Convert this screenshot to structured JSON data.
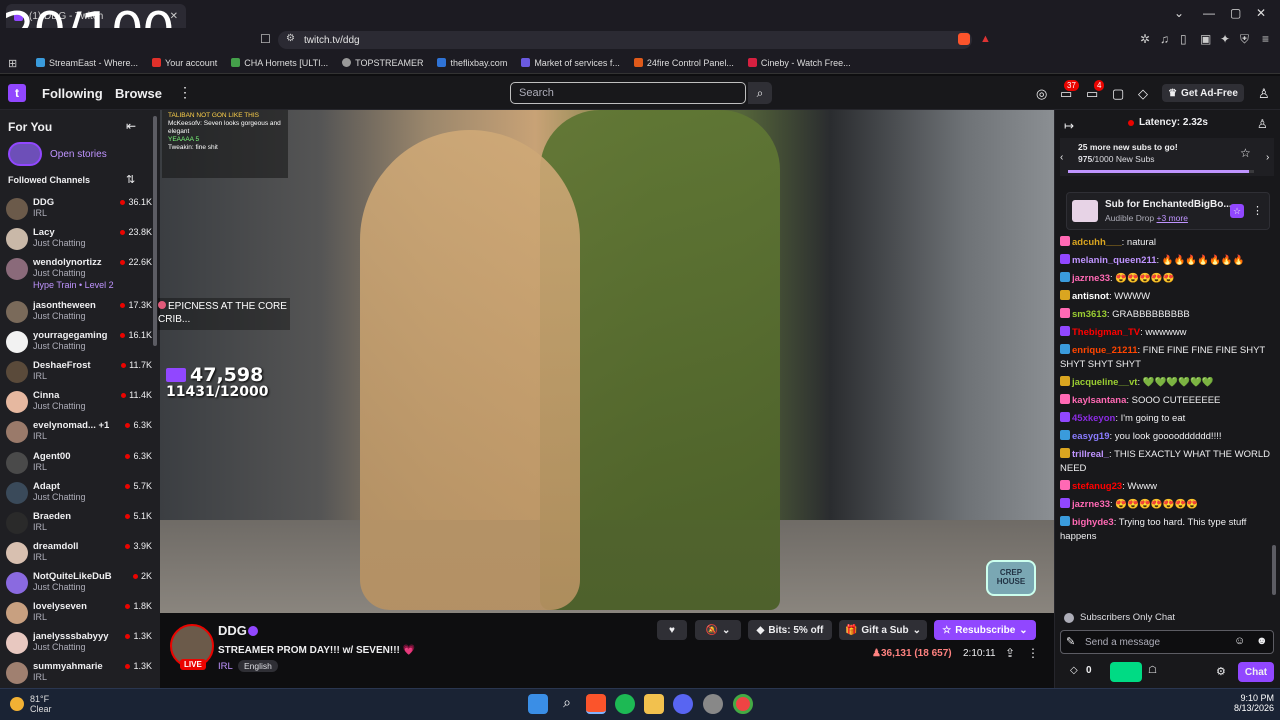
{
  "browser": {
    "tab_title": "(1) DDG - Twitch",
    "url": "twitch.tv/ddg",
    "overlay_counter": "20/100",
    "bookmarks": [
      {
        "label": "StreamEast - Where...",
        "color": "#3a9bdc"
      },
      {
        "label": "Your account",
        "color": "#e0302a"
      },
      {
        "label": "CHA Hornets [ULTI...",
        "color": "#44a04a"
      },
      {
        "label": "TOPSTREAMER",
        "color": "#999999"
      },
      {
        "label": "theflixbay.com",
        "color": "#2f73d6"
      },
      {
        "label": "Market of services f...",
        "color": "#6a5ae0"
      },
      {
        "label": "24fire Control Panel...",
        "color": "#e05a1a"
      },
      {
        "label": "Cineby - Watch Free...",
        "color": "#d62040"
      }
    ]
  },
  "header": {
    "following": "Following",
    "browse": "Browse",
    "search_placeholder": "Search",
    "notif_count": "37",
    "inbox_count": "4",
    "ad_free": "Get Ad-Free"
  },
  "sidebar": {
    "for_you": "For You",
    "open_stories": "Open stories",
    "followed_channels": "Followed Channels",
    "channels": [
      {
        "name": "DDG",
        "category": "IRL",
        "viewers": "36.1K",
        "color": "#6b5a4a"
      },
      {
        "name": "Lacy",
        "category": "Just Chatting",
        "viewers": "23.8K",
        "color": "#c9b8a8"
      },
      {
        "name": "wendolynortizz",
        "category": "Just Chatting",
        "viewers": "22.6K",
        "hype": "Hype Train • Level 2",
        "color": "#8a6a7a"
      },
      {
        "name": "jasontheween",
        "category": "Just Chatting",
        "viewers": "17.3K",
        "color": "#7a6a5a"
      },
      {
        "name": "yourragegaming",
        "category": "Just Chatting",
        "viewers": "16.1K",
        "color": "#f2f2f2"
      },
      {
        "name": "DeshaeFrost",
        "category": "IRL",
        "viewers": "11.7K",
        "color": "#5a4a3a"
      },
      {
        "name": "Cinna",
        "category": "Just Chatting",
        "viewers": "11.4K",
        "color": "#e6b8a0"
      },
      {
        "name": "evelynomad... +1",
        "category": "IRL",
        "viewers": "6.3K",
        "color": "#9a7a6a"
      },
      {
        "name": "Agent00",
        "category": "IRL",
        "viewers": "6.3K",
        "color": "#4a4a4a"
      },
      {
        "name": "Adapt",
        "category": "Just Chatting",
        "viewers": "5.7K",
        "color": "#3a4a5a"
      },
      {
        "name": "Braeden",
        "category": "IRL",
        "viewers": "5.1K",
        "color": "#2a2a2a"
      },
      {
        "name": "dreamdoll",
        "category": "IRL",
        "viewers": "3.9K",
        "color": "#d8c0b0"
      },
      {
        "name": "NotQuiteLikeDuB",
        "category": "Just Chatting",
        "viewers": "2K",
        "color": "#8a6ae0"
      },
      {
        "name": "lovelyseven",
        "category": "IRL",
        "viewers": "1.8K",
        "color": "#c8a080"
      },
      {
        "name": "janelysssbabyyy",
        "category": "Just Chatting",
        "viewers": "1.3K",
        "color": "#e8c8c0"
      },
      {
        "name": "summyahmarie",
        "category": "IRL",
        "viewers": "1.3K",
        "color": "#a08070"
      }
    ]
  },
  "video_overlay": {
    "chat_lines": [
      {
        "text": "TALIBAN NOT GON LIKE THIS",
        "color": "#ffffff"
      },
      {
        "text": "McKeesofv: Seven looks gorgeous and elegant",
        "color": "#ffffff"
      },
      {
        "text": "YEAAAA 5",
        "color": "#7cff7c"
      },
      {
        "text": "Tweakin: fine shit",
        "color": "#ffffff"
      }
    ],
    "caption": "EPICNESS AT THE CORE CRIB...",
    "sub_count": "47,598",
    "sub_goal": "11431/12000",
    "logo_text": "CREP HOUSE"
  },
  "stream_info": {
    "channel": "DDG",
    "live": "LIVE",
    "title": "STREAMER PROM DAY!!! w/ SEVEN!!! 💗",
    "category": "IRL",
    "language": "English",
    "bits": "Bits: 5% off",
    "gift": "Gift a Sub",
    "resub": "Resubscribe",
    "viewers": "36,131 (18 657)",
    "uptime": "2:10:11"
  },
  "chat": {
    "latency": "Latency: 2.32s",
    "goal_line1": "25 more new subs to go!",
    "goal_count": "975",
    "goal_line2": "/1000 New Subs",
    "goal_fraction": 0.975,
    "drop_title": "Sub for EnchantedBigBo...",
    "drop_sub": "Audible Drop",
    "drop_more": "+3 more",
    "messages": [
      {
        "user": "adcuhh___",
        "color": "#daa520",
        "text": ": natural"
      },
      {
        "user": "melanin_queen211",
        "color": "#bf94ff",
        "text": ": 🔥🔥🔥🔥🔥🔥🔥"
      },
      {
        "user": "jazrne33",
        "color": "#ff69b4",
        "text": ": 😍😍😍😍😍"
      },
      {
        "user": "antisnot",
        "color": "#ffffff",
        "text": ": WWWW"
      },
      {
        "user": "sm3613",
        "color": "#9acd32",
        "text": ": GRABBBBBBBBB"
      },
      {
        "user": "Thebigman_TV",
        "color": "#ff0000",
        "text": ": wwwwww"
      },
      {
        "user": "enrique_21211",
        "color": "#ff4500",
        "text": ": FINE FINE FINE FINE SHYT SHYT SHYT SHYT"
      },
      {
        "user": "jacqueline__vt",
        "color": "#9acd32",
        "text": ": 💚💚💚💚💚💚"
      },
      {
        "user": "kaylsantana",
        "color": "#ff69b4",
        "text": ": SOOO CUTEEEEEE"
      },
      {
        "user": "45xkeyon",
        "color": "#8a2be2",
        "text": ": I'm going to eat"
      },
      {
        "user": "easyg19",
        "color": "#8a7cff",
        "text": ": you look goooodddddd!!!!"
      },
      {
        "user": "trillreal_",
        "color": "#bf94ff",
        "text": ": THIS EXACTLY WHAT THE WORLD NEED"
      },
      {
        "user": "stefanug23",
        "color": "#ff0000",
        "text": ": Wwww"
      },
      {
        "user": "jazrne33",
        "color": "#ff69b4",
        "text": ": 😍😍😍😍😍😍😍"
      },
      {
        "user": "bighyde3",
        "color": "#ff69b4",
        "text": ": Trying too hard. This type stuff happens"
      }
    ],
    "subs_only": "Subscribers Only Chat",
    "send_placeholder": "Send a message",
    "points": "0",
    "chat_button": "Chat"
  },
  "taskbar": {
    "temp": "81°F",
    "condition": "Clear",
    "time": "9:10 PM",
    "date": "8/13/2026"
  }
}
